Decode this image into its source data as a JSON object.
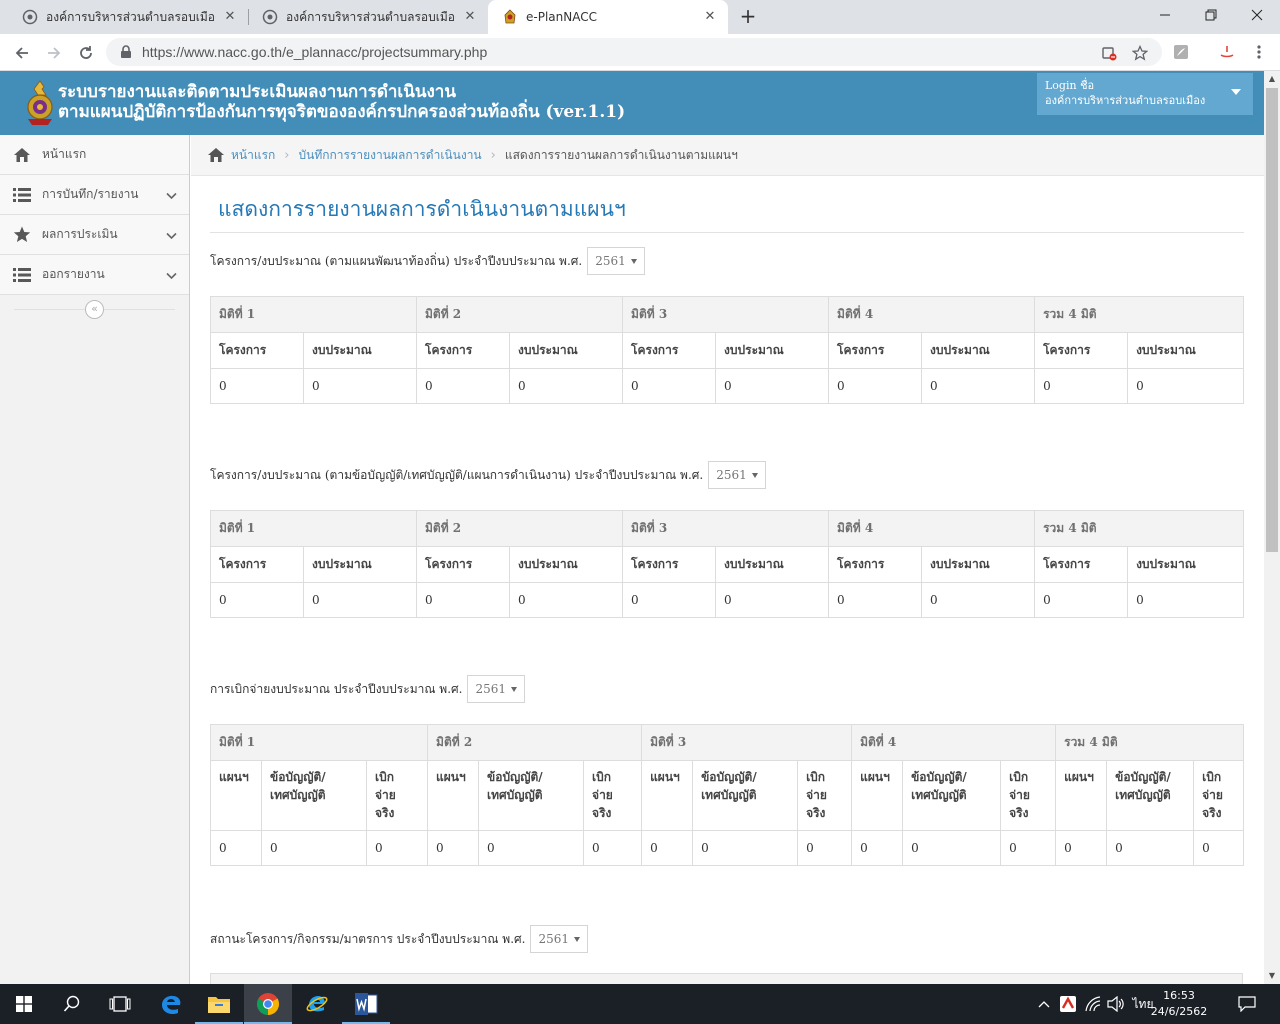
{
  "browser": {
    "tabs": [
      {
        "title": "องค์การบริหารส่วนตำบลรอบเมือง อำเภ"
      },
      {
        "title": "องค์การบริหารส่วนตำบลรอบเมือง อำเภ"
      },
      {
        "title": "e-PlanNACC"
      }
    ],
    "new_tab": "+",
    "url": "https://www.nacc.go.th/e_plannacc/projectsummary.php"
  },
  "header": {
    "title_line1": "ระบบรายงานและติดตามประเมินผลงานการดำเนินงาน",
    "title_line2": "ตามแผนปฏิบัติการป้องกันการทุจริตขององค์กรปกครองส่วนท้องถิ่น (ver.1.1)",
    "login_label": "Login ชื่อ",
    "login_org": "องค์การบริหารส่วนตำบลรอบเมือง"
  },
  "sidebar": {
    "items": [
      {
        "label": "หน้าแรก",
        "icon": "home-icon"
      },
      {
        "label": "การบันทึก/รายงาน",
        "icon": "list-icon"
      },
      {
        "label": "ผลการประเมิน",
        "icon": "star-icon"
      },
      {
        "label": "ออกรายงาน",
        "icon": "list-icon"
      }
    ],
    "collapse": "«"
  },
  "breadcrumb": {
    "home": "หน้าแรก",
    "level2": "บันทึกการรายงานผลการดำเนินงาน",
    "current": "แสดงการรายงานผลการดำเนินงานตามแผนฯ"
  },
  "page": {
    "title": "แสดงการรายงานผลการดำเนินงานตามแผนฯ",
    "dimension_headers": [
      "มิติที่ 1",
      "มิติที่ 2",
      "มิติที่ 3",
      "มิติที่ 4",
      "รวม 4 มิติ"
    ],
    "sections": [
      {
        "label": "โครงการ/งบประมาณ (ตามแผนพัฒนาท้องถิ่น) ประจำปีงบประมาณ พ.ศ.",
        "year": "2561",
        "cols": [
          "โครงการ",
          "งบประมาณ"
        ],
        "values": [
          "0",
          "0",
          "0",
          "0",
          "0",
          "0",
          "0",
          "0",
          "0",
          "0"
        ]
      },
      {
        "label": "โครงการ/งบประมาณ (ตามข้อบัญญัติ/เทศบัญญัติ/แผนการดำเนินงาน) ประจำปีงบประมาณ พ.ศ.",
        "year": "2561",
        "cols": [
          "โครงการ",
          "งบประมาณ"
        ],
        "values": [
          "0",
          "0",
          "0",
          "0",
          "0",
          "0",
          "0",
          "0",
          "0",
          "0"
        ]
      },
      {
        "label": "การเบิกจ่ายงบประมาณ ประจำปีงบประมาณ พ.ศ.",
        "year": "2561",
        "cols": [
          {
            "l1": "แผนฯ",
            "l2": "",
            "l3": ""
          },
          {
            "l1": "ข้อบัญญัติ/",
            "l2": "เทศบัญญัติ",
            "l3": ""
          },
          {
            "l1": "เบิก",
            "l2": "จ่าย",
            "l3": "จริง"
          }
        ],
        "values": [
          "0",
          "0",
          "0",
          "0",
          "0",
          "0",
          "0",
          "0",
          "0",
          "0",
          "0",
          "0",
          "0",
          "0",
          "0"
        ]
      },
      {
        "label": "สถานะโครงการ/กิจกรรม/มาตรการ ประจำปีงบประมาณ พ.ศ.",
        "year": "2561"
      }
    ]
  },
  "taskbar": {
    "language": "ไทย",
    "time": "16:53",
    "date": "24/6/2562"
  },
  "colors": {
    "header_bg": "#438eb9",
    "login_bg": "#62a8d1",
    "title_blue": "#2679b5",
    "link_blue": "#4c8fbd"
  }
}
